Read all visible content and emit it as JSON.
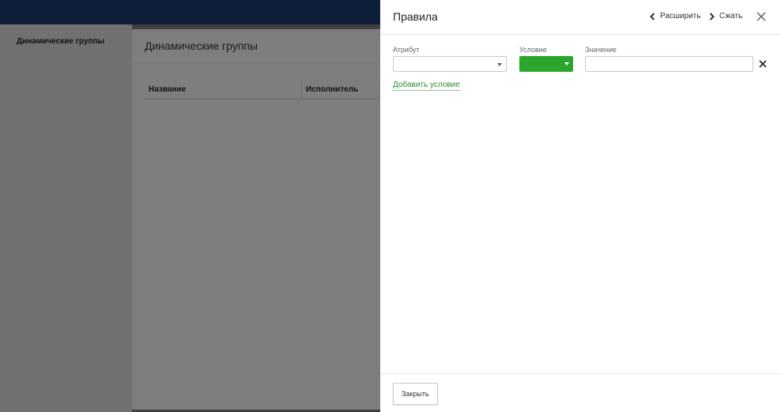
{
  "background": {
    "nav_title": "Динамические группы",
    "card_title": "Динамические группы",
    "table_columns": [
      "Название",
      "Исполнитель"
    ]
  },
  "panel": {
    "title": "Правила",
    "expand_label": "Расширить",
    "collapse_label": "Сжать",
    "labels": {
      "attribute": "Атрибут",
      "condition": "Условие",
      "value": "Значение"
    },
    "attribute_value": "",
    "condition_value": "",
    "value_input": "",
    "add_condition_label": "Добавить условие",
    "close_button_label": "Закрыть"
  },
  "colors": {
    "topbar": "#1d3c6e",
    "condition_select": "#2ca52c",
    "link": "#2e8b2e"
  },
  "icons": [
    "chevron-left-icon",
    "chevron-right-icon",
    "close-icon",
    "remove-condition-icon",
    "caret-down-icon"
  ]
}
